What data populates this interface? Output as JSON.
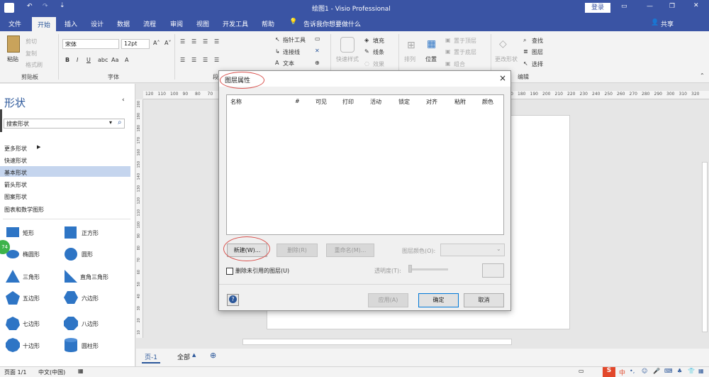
{
  "window": {
    "title": "绘图1 - Visio Professional",
    "login": "登录"
  },
  "tabs": [
    "文件",
    "开始",
    "插入",
    "设计",
    "数据",
    "流程",
    "审阅",
    "视图",
    "开发工具",
    "帮助"
  ],
  "tell_me": "告诉我你想要做什么",
  "share": "共享",
  "ribbon": {
    "paste": "粘贴",
    "cut": "剪切",
    "copy": "复制",
    "format_painter": "格式刷",
    "clipboard": "剪贴板",
    "font_name": "宋体",
    "font_size": "12pt",
    "font_group": "字体",
    "para_group": "段",
    "pointer_tool": "指针工具",
    "connector": "连接线",
    "text": "文本",
    "fill": "填充",
    "line": "线条",
    "effects": "效果",
    "quick_styles": "快速样式",
    "arrange": "排列",
    "position": "位置",
    "bring_front": "置于顶层",
    "send_back": "置于底层",
    "group": "组合",
    "change_shape": "更改形状",
    "find": "查找",
    "layers": "图层",
    "select": "选择",
    "editing": "编辑"
  },
  "shapes": {
    "title": "形状",
    "search_placeholder": "搜索形状",
    "more_shapes": "更多形状",
    "categories": [
      "快速形状",
      "基本形状",
      "箭头形状",
      "图案形状",
      "图表和数学图形"
    ],
    "items": [
      {
        "label": "矩形",
        "icon": "rectangle-icon"
      },
      {
        "label": "正方形",
        "icon": "square-icon"
      },
      {
        "label": "椭圆形",
        "icon": "ellipse-icon"
      },
      {
        "label": "圆形",
        "icon": "circle-icon"
      },
      {
        "label": "三角形",
        "icon": "triangle-icon"
      },
      {
        "label": "直角三角形",
        "icon": "right-triangle-icon"
      },
      {
        "label": "五边形",
        "icon": "pentagon-icon"
      },
      {
        "label": "六边形",
        "icon": "hexagon-icon"
      },
      {
        "label": "七边形",
        "icon": "heptagon-icon"
      },
      {
        "label": "八边形",
        "icon": "octagon-icon"
      },
      {
        "label": "十边形",
        "icon": "decagon-icon"
      },
      {
        "label": "圆柱形",
        "icon": "cylinder-icon"
      }
    ],
    "badge": "74"
  },
  "ruler": {
    "top": [
      "120",
      "110",
      "100",
      "90",
      "80",
      "70",
      "60",
      "50",
      "40",
      "30",
      "20",
      "10",
      "0",
      "10",
      "20",
      "30",
      "40",
      "50",
      "60",
      "70",
      "80",
      "90",
      "100",
      "110",
      "120",
      "130",
      "140",
      "150",
      "160",
      "170",
      "180",
      "190",
      "200",
      "210",
      "220",
      "230",
      "240",
      "250",
      "260",
      "270",
      "280",
      "290",
      "300",
      "310",
      "320"
    ],
    "left": [
      "200",
      "190",
      "180",
      "170",
      "160",
      "150",
      "140",
      "130",
      "120",
      "110",
      "100",
      "90",
      "80",
      "70",
      "60",
      "50",
      "40",
      "30",
      "20",
      "10"
    ]
  },
  "pages": {
    "tab": "页-1",
    "all": "全部"
  },
  "status": {
    "page": "页面 1/1",
    "language": "中文(中国)"
  },
  "dialog": {
    "title": "图层属性",
    "columns": [
      "名称",
      "#",
      "可见",
      "打印",
      "活动",
      "锁定",
      "对齐",
      "粘附",
      "颜色"
    ],
    "new": "新建(W)...",
    "delete": "删除(R)",
    "rename": "重命名(M)...",
    "layer_color": "图层颜色(O):",
    "remove_unused": "删除未引用的图层(U)",
    "transparency": "透明度(T):",
    "apply": "应用(A)",
    "ok": "确定",
    "cancel": "取消",
    "close": "×",
    "help": "?"
  },
  "colors": {
    "accent": "#3a54a4",
    "highlight_circle": "#d9534f",
    "shape_fill": "#2e75c5"
  }
}
